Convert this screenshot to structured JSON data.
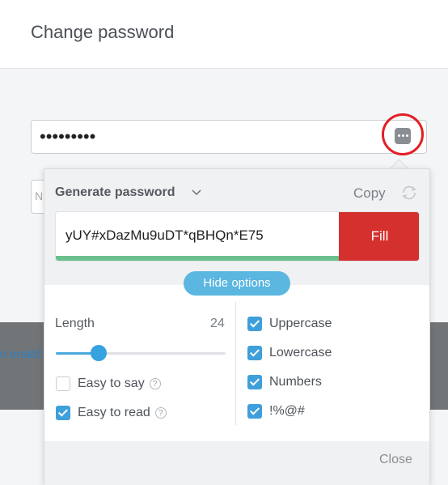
{
  "header": {
    "title": "Change password"
  },
  "password_field": {
    "masked_value": "•••••••••"
  },
  "partial_text": {
    "left_link": "o enabl",
    "field_stub": "N"
  },
  "generator": {
    "title": "Generate password",
    "copy_label": "Copy",
    "generated_password": "yUY#xDazMu9uDT*qBHQn*E75",
    "fill_label": "Fill",
    "strength": 0.8,
    "hide_options_label": "Hide options",
    "length_label": "Length",
    "length_value": "24",
    "length_slider": 0.25,
    "left_options": [
      {
        "label": "Easy to say",
        "checked": false
      },
      {
        "label": "Easy to read",
        "checked": true
      }
    ],
    "right_options": [
      {
        "label": "Uppercase",
        "checked": true
      },
      {
        "label": "Lowercase",
        "checked": true
      },
      {
        "label": "Numbers",
        "checked": true
      },
      {
        "label": "!%@#",
        "checked": true
      }
    ],
    "close_label": "Close"
  },
  "colors": {
    "fill_button": "#d4302e",
    "accent_blue": "#3f9fdb",
    "strength_green": "#6bc18c",
    "highlight_ring": "#e31e24"
  },
  "icons": [
    "dots-generator-icon",
    "chevron-down-icon",
    "refresh-icon",
    "help-icon",
    "check-icon"
  ]
}
